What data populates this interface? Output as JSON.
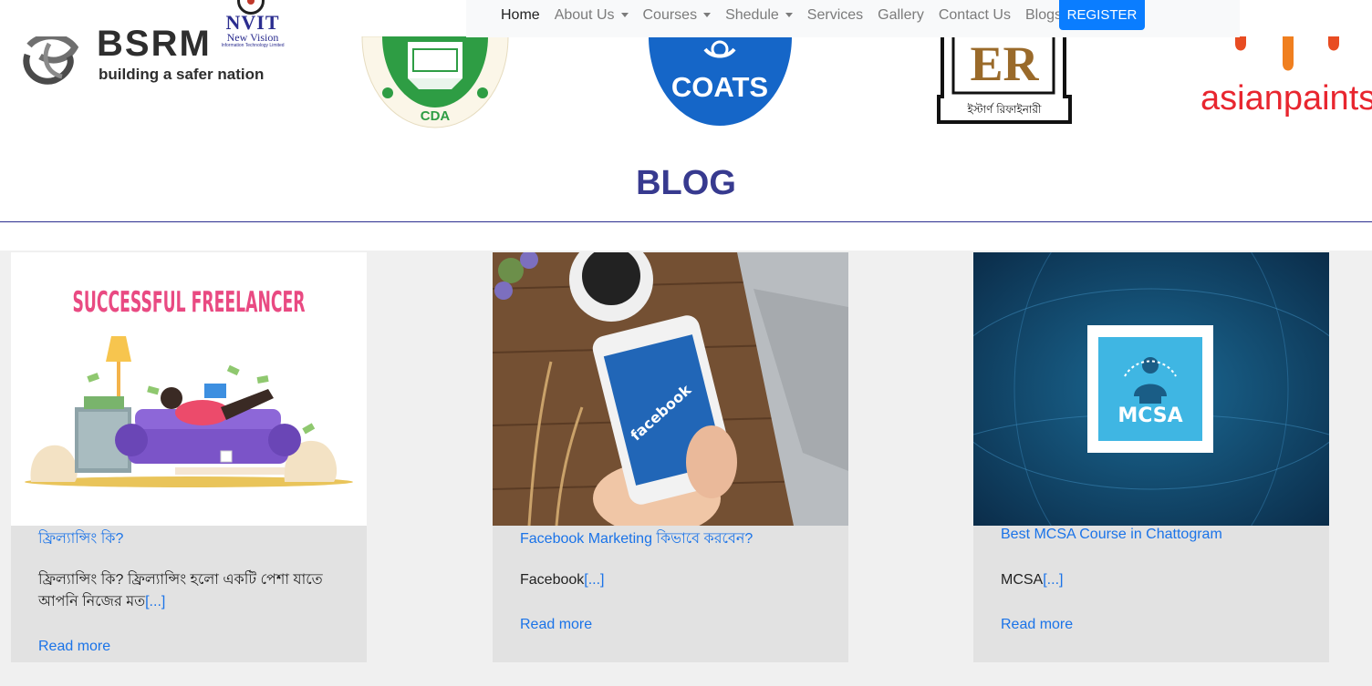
{
  "header": {
    "logo": {
      "name": "NVIT",
      "subtitle": "New Vision",
      "tagline": "Information Technology Limited"
    },
    "nav": [
      {
        "label": "Home",
        "active": true,
        "dropdown": false
      },
      {
        "label": "About Us",
        "active": false,
        "dropdown": true
      },
      {
        "label": "Courses",
        "active": false,
        "dropdown": true
      },
      {
        "label": "Shedule",
        "active": false,
        "dropdown": true
      },
      {
        "label": "Services",
        "active": false,
        "dropdown": false
      },
      {
        "label": "Gallery",
        "active": false,
        "dropdown": false
      },
      {
        "label": "Contact Us",
        "active": false,
        "dropdown": false
      },
      {
        "label": "Blogs",
        "active": false,
        "dropdown": false
      }
    ],
    "register_label": "REGISTER"
  },
  "partners": {
    "bsrm": {
      "name": "BSRM",
      "tagline": "building a safer nation"
    },
    "cda": {
      "name": "CDA"
    },
    "coats": {
      "name": "COATS"
    },
    "eastern": {
      "name": "ER",
      "bangla": "ইস্টার্ণ রিফাইনারী"
    },
    "asianpaints": {
      "name": "asianpaints"
    }
  },
  "blog": {
    "heading": "BLOG",
    "cards": [
      {
        "image_text": "SUCCESSFUL FREELANCER",
        "title": "ফ্রিল্যান্সিং কি?",
        "excerpt": "ফ্রিল্যান্সিং কি? ফ্রিল্যান্সিং হলো একটি পেশা যাতে আপনি নিজের মত",
        "more": "[...]",
        "read_more": "Read more"
      },
      {
        "image_text": "facebook",
        "title": "Facebook Marketing কিভাবে করবেন?",
        "excerpt": "Facebook",
        "more": "[...]",
        "read_more": "Read more"
      },
      {
        "image_text": "MCSA",
        "title": "Best MCSA Course in Chattogram",
        "excerpt": "MCSA",
        "more": "[...]",
        "read_more": "Read more"
      }
    ]
  },
  "colors": {
    "brand_navy": "#2b2d8f",
    "link_blue": "#1a73e8",
    "register_blue": "#0a7dff"
  }
}
